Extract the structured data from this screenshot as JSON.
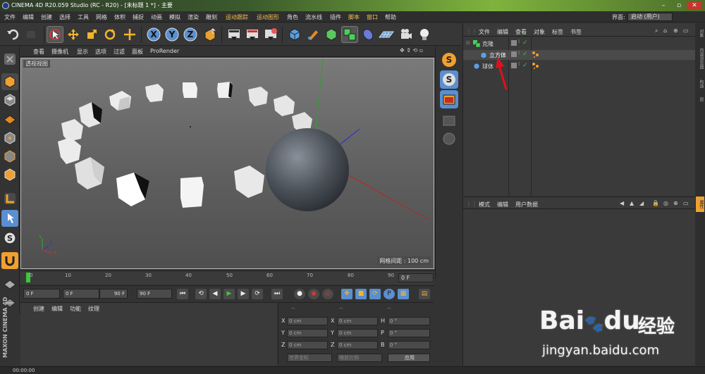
{
  "window": {
    "title": "CINEMA 4D R20.059 Studio (RC - R20) - [未标题 1 *] - 主要"
  },
  "menubar": {
    "items": [
      "文件",
      "编辑",
      "创建",
      "选择",
      "工具",
      "网格",
      "体积",
      "捕捉",
      "动画",
      "模拟",
      "渲染",
      "雕刻",
      "运动跟踪",
      "运动图形",
      "角色",
      "流水线",
      "插件",
      "脚本",
      "窗口",
      "帮助"
    ],
    "layout_label": "界面:",
    "layout_value": "启动 (用户)"
  },
  "toolbar": {
    "icons": [
      "undo-icon",
      "redo-icon",
      "live-select-icon",
      "move-icon",
      "scale-icon",
      "rotate-icon",
      "recent-tool-icon",
      "x-axis-icon",
      "y-axis-icon",
      "z-axis-icon",
      "coordinate-system-icon",
      "render-view-icon",
      "render-to-picture-viewer-icon",
      "render-settings-icon",
      "cube-object-icon",
      "pen-icon",
      "subdivision-icon",
      "cloner-icon",
      "deformer-icon",
      "floor-icon",
      "camera-icon",
      "light-icon"
    ]
  },
  "viewport": {
    "menu": [
      "查看",
      "摄像机",
      "显示",
      "选项",
      "过滤",
      "面板",
      "ProRender"
    ],
    "label": "透视视图",
    "grid_spacing": "网格间距 : 100 cm",
    "axis_labels": {
      "x": "X",
      "y": "Y",
      "z": "Z"
    }
  },
  "timeline": {
    "ticks": [
      "0",
      "10",
      "20",
      "30",
      "40",
      "50",
      "60",
      "70",
      "80",
      "90"
    ],
    "current_frame": "0 F"
  },
  "transport": {
    "start_frame": "0 F",
    "range_start": "0 F",
    "range_end": "90 F",
    "end_frame": "90 F"
  },
  "material_panel": {
    "menu": [
      "创建",
      "编辑",
      "功能",
      "纹理"
    ]
  },
  "coord_panel": {
    "headers": [
      "--",
      "--",
      "--"
    ],
    "rows": [
      {
        "a": "X",
        "av": "0 cm",
        "b": "X",
        "bv": "0 cm",
        "c": "H",
        "cv": "0 °"
      },
      {
        "a": "Y",
        "av": "0 cm",
        "b": "Y",
        "bv": "0 cm",
        "c": "P",
        "cv": "0 °"
      },
      {
        "a": "Z",
        "av": "0 cm",
        "b": "Z",
        "bv": "0 cm",
        "c": "B",
        "cv": "0 °"
      }
    ],
    "world_coords": "世界坐标",
    "scale_ratio": "缩放比例",
    "apply": "应用"
  },
  "object_manager": {
    "menu": [
      "文件",
      "编辑",
      "查看",
      "对象",
      "标签",
      "书签"
    ],
    "objects": [
      {
        "name": "克隆",
        "icon": "cloner-icon",
        "indent": 0
      },
      {
        "name": "立方体",
        "icon": "cube-icon",
        "indent": 1
      },
      {
        "name": "球体",
        "icon": "sphere-icon",
        "indent": 0
      }
    ]
  },
  "attribute_manager": {
    "menu": [
      "模式",
      "编辑",
      "用户数据"
    ]
  },
  "side_tabs": [
    "对象",
    "内容浏览器",
    "构造",
    "层",
    "属性"
  ],
  "status": {
    "time": "00:00:00"
  },
  "brand": {
    "maxon": "MAXON CINEMA 4D"
  },
  "watermark": {
    "logo": "Bai",
    "logo2": "du",
    "cn": "经验",
    "url": "jingyan.baidu.com"
  },
  "colors": {
    "accent_orange": "#f0a030",
    "selection_blue": "#5a8fd0",
    "arrow_red": "#e0101c"
  }
}
